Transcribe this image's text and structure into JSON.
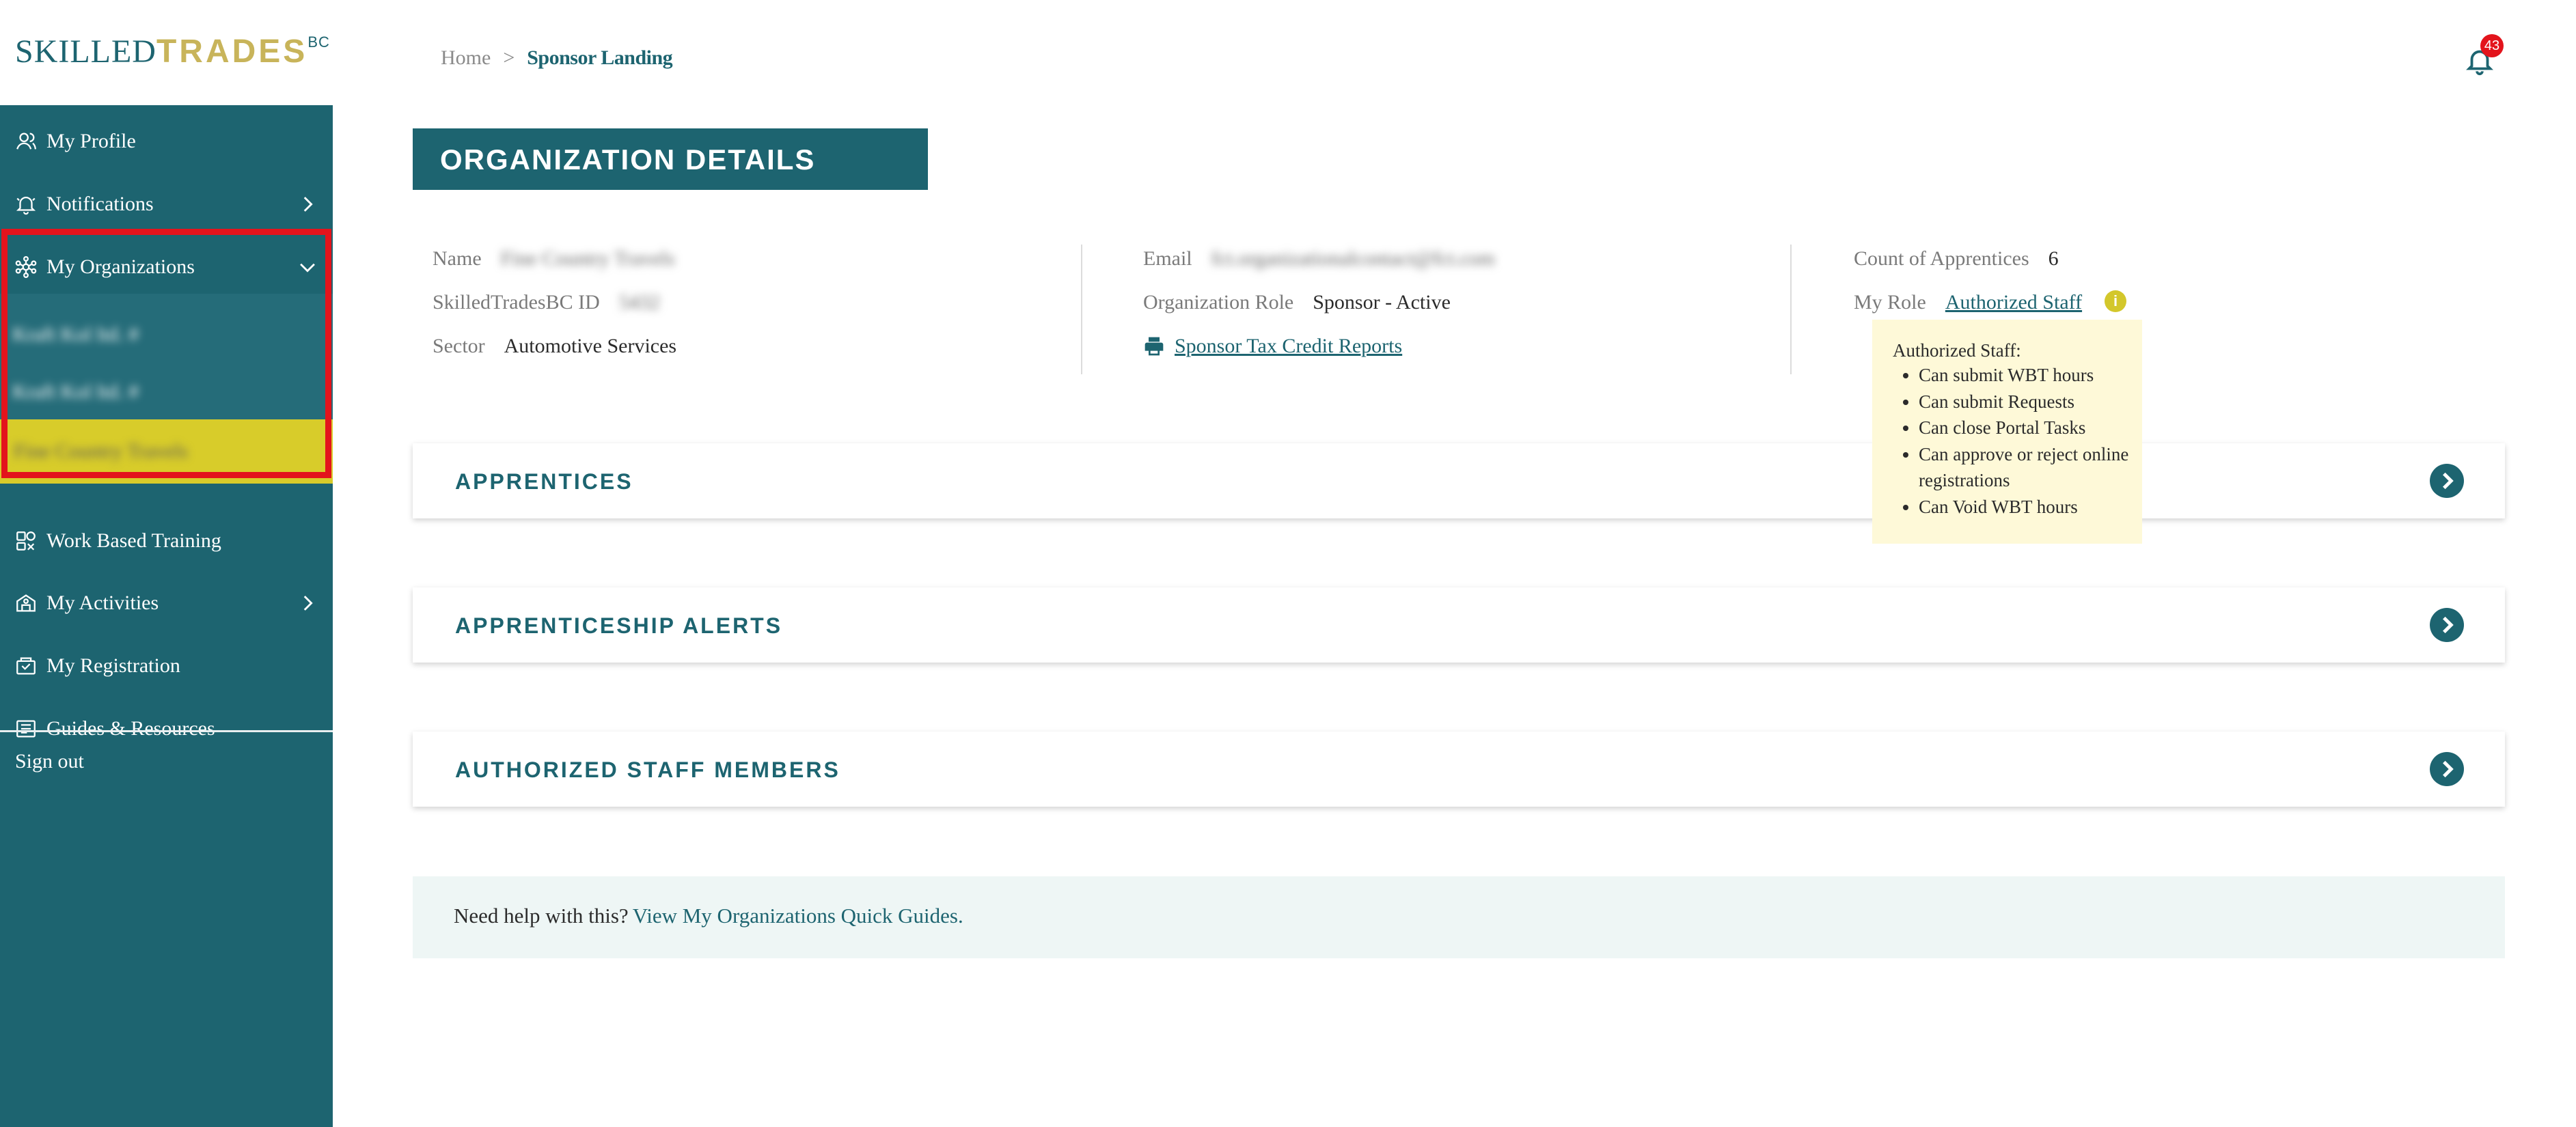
{
  "logo": {
    "part1": "SKILLED",
    "part2": "TRADES",
    "part3": "BC"
  },
  "sidebar": {
    "items": [
      {
        "label": "My Profile",
        "icon": "user-icon"
      },
      {
        "label": "Notifications",
        "icon": "bell-icon"
      },
      {
        "label": "My Organizations",
        "icon": "network-icon"
      },
      {
        "label": "Work Based Training",
        "icon": "training-icon"
      },
      {
        "label": "My Activities",
        "icon": "activities-icon"
      },
      {
        "label": "My Registration",
        "icon": "registration-icon"
      },
      {
        "label": "Guides & Resources",
        "icon": "guides-icon"
      }
    ],
    "sub_items": [
      "Kraft Kol ltd. #",
      "Kraft Kol ltd. #",
      "Fine Country Travels"
    ],
    "signout": "Sign out"
  },
  "header": {
    "breadcrumb": {
      "home": "Home",
      "sep": ">",
      "current": "Sponsor Landing"
    },
    "notification_count": "43"
  },
  "title": "ORGANIZATION DETAILS",
  "details": {
    "name_label": "Name",
    "name_value": "Fine Country Travels",
    "id_label": "SkilledTradesBC ID",
    "id_value": "5432",
    "sector_label": "Sector",
    "sector_value": "Automotive Services",
    "email_label": "Email",
    "email_value": "fct.organizationalcontact@fct.com",
    "role_label": "Organization Role",
    "role_value": "Sponsor - Active",
    "tax_link": "Sponsor Tax Credit Reports",
    "count_label": "Count of Apprentices",
    "count_value": "6",
    "myrole_label": "My Role",
    "myrole_value": "Authorized Staff",
    "info_glyph": "i"
  },
  "tooltip": {
    "title": "Authorized Staff:",
    "items": [
      "Can submit WBT hours",
      "Can submit Requests",
      "Can close Portal Tasks",
      "Can approve or reject online registrations",
      "Can Void WBT hours"
    ]
  },
  "accordions": [
    "APPRENTICES",
    "APPRENTICESHIP ALERTS",
    "AUTHORIZED STAFF MEMBERS"
  ],
  "help": {
    "text": "Need help with this?",
    "link": "View My Organizations Quick Guides."
  },
  "colors": {
    "primary": "#1d6470",
    "accent": "#c8b45a",
    "active_item": "#d8cc2a",
    "highlight": "#e3141c",
    "tooltip_bg": "#fef9d8",
    "help_bg": "#eef6f5"
  }
}
